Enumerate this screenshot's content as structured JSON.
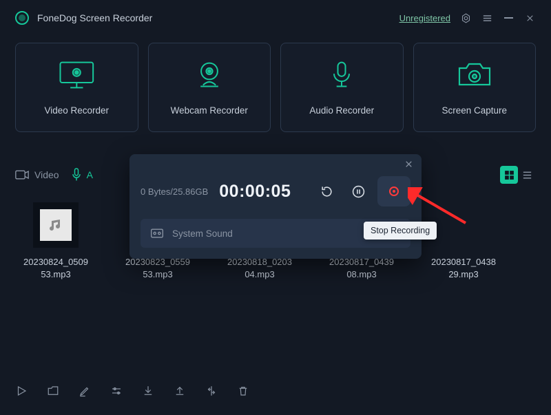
{
  "header": {
    "app_title": "FoneDog Screen Recorder",
    "register_link": "Unregistered"
  },
  "modes": [
    {
      "label": "Video Recorder",
      "icon": "monitor-record"
    },
    {
      "label": "Webcam Recorder",
      "icon": "webcam"
    },
    {
      "label": "Audio Recorder",
      "icon": "microphone"
    },
    {
      "label": "Screen Capture",
      "icon": "camera"
    }
  ],
  "library": {
    "tab_video": "Video",
    "tab_audio_initial": "A"
  },
  "recording_panel": {
    "stats": "0 Bytes/25.86GB",
    "time": "00:00:05",
    "source_label": "System Sound",
    "tooltip": "Stop Recording"
  },
  "files": [
    {
      "name_line1": "20230824_0509",
      "name_line2": "53.mp3"
    },
    {
      "name_line1": "20230823_0559",
      "name_line2": "53.mp3"
    },
    {
      "name_line1": "20230818_0203",
      "name_line2": "04.mp3"
    },
    {
      "name_line1": "20230817_0439",
      "name_line2": "08.mp3"
    },
    {
      "name_line1": "20230817_0438",
      "name_line2": "29.mp3"
    }
  ]
}
